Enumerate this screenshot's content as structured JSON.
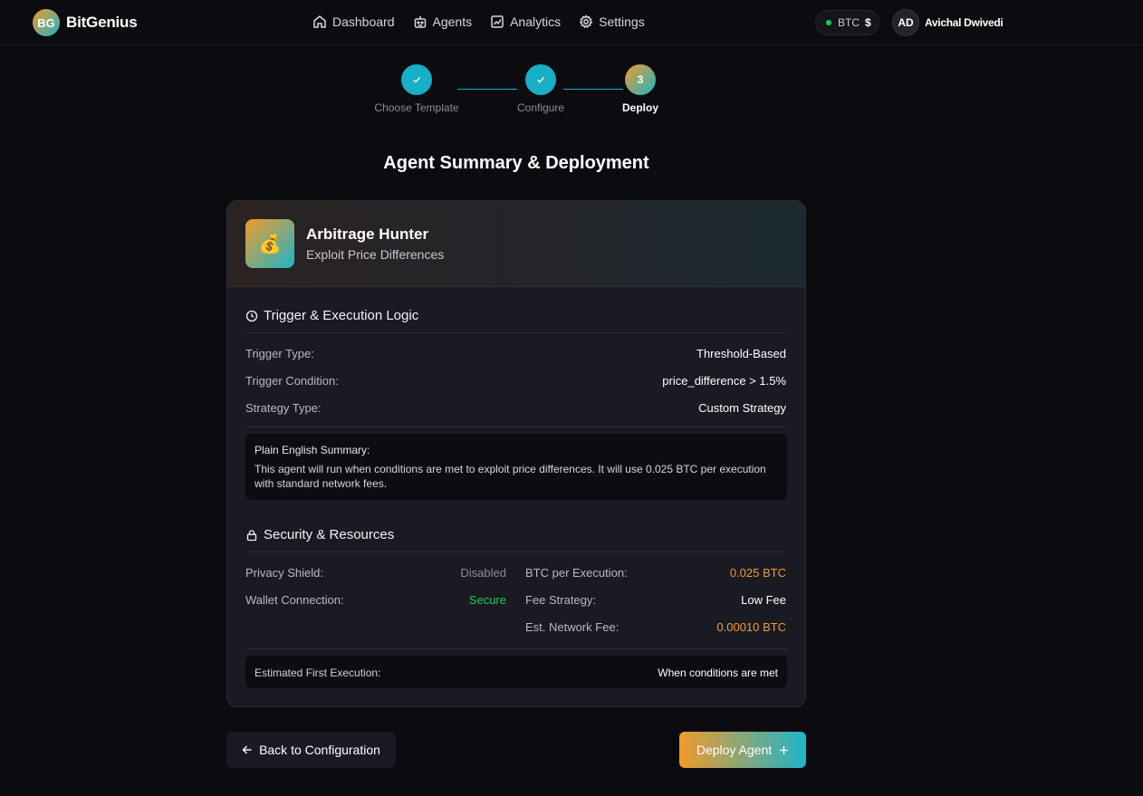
{
  "brand": {
    "logo_text": "BG",
    "name": "BitGenius"
  },
  "nav": {
    "links": [
      {
        "label": "Dashboard",
        "icon": "home-icon"
      },
      {
        "label": "Agents",
        "icon": "robot-icon"
      },
      {
        "label": "Analytics",
        "icon": "chart-icon"
      },
      {
        "label": "Settings",
        "icon": "gear-icon"
      }
    ],
    "btc_label": "BTC",
    "btc_price": "$",
    "user_initials": "AD",
    "user_name": "Avichal Dwivedi"
  },
  "stepper": {
    "steps": [
      {
        "label": "Choose Template",
        "state": "done"
      },
      {
        "label": "Configure",
        "state": "done"
      },
      {
        "label": "Deploy",
        "state": "active",
        "number": "3"
      }
    ]
  },
  "page_title": "Agent Summary & Deployment",
  "agent": {
    "icon": "money-bag-icon",
    "icon_glyph": "💰",
    "name": "Arbitrage Hunter",
    "subtitle": "Exploit Price Differences"
  },
  "trigger_section": {
    "title": "Trigger & Execution Logic",
    "rows": [
      {
        "label": "Trigger Type:",
        "value": "Threshold-Based"
      },
      {
        "label": "Trigger Condition:",
        "value": "price_difference > 1.5%"
      },
      {
        "label": "Strategy Type:",
        "value": "Custom Strategy"
      }
    ],
    "summary_label": "Plain English Summary:",
    "summary_text": "This agent will run when conditions are met to exploit price differences. It will use 0.025 BTC per execution with standard network fees."
  },
  "security_section": {
    "title": "Security & Resources",
    "left_rows": [
      {
        "label": "Privacy Shield:",
        "value": "Disabled"
      },
      {
        "label": "Wallet Connection:",
        "value": "Secure"
      }
    ],
    "right_rows": [
      {
        "label": "BTC per Execution:",
        "value": "0.025 BTC"
      },
      {
        "label": "Fee Strategy:",
        "value": "Low Fee"
      },
      {
        "label": "Est. Network Fee:",
        "value": "0.00010 BTC"
      }
    ],
    "est_label": "Estimated First Execution:",
    "est_value": "When conditions are met"
  },
  "buttons": {
    "back": "Back to Configuration",
    "deploy": "Deploy Agent"
  },
  "colors": {
    "accent_orange": "#f19a2b",
    "accent_teal": "#1fb4c8",
    "status_green": "#22c55e",
    "background": "#0c0c10"
  }
}
